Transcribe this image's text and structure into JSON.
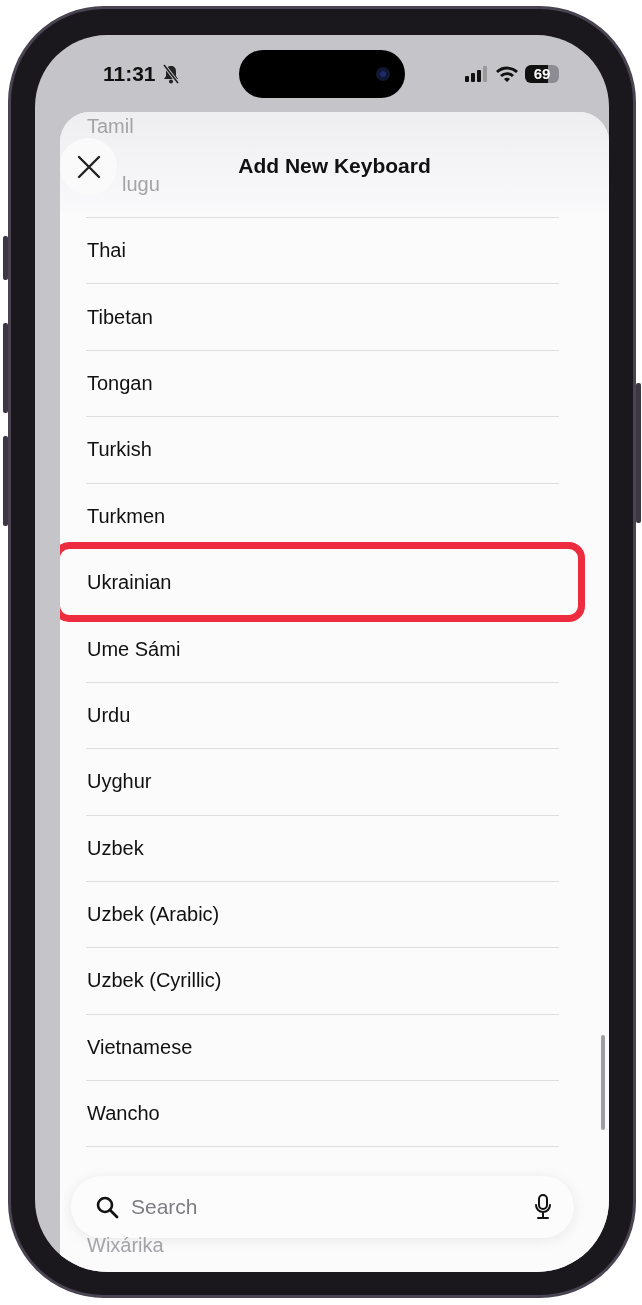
{
  "status_bar": {
    "time": "11:31",
    "silent": true,
    "battery": "69"
  },
  "sheet": {
    "title": "Add New Keyboard",
    "faded_top": [
      "Tamil",
      "lugu"
    ],
    "items": [
      {
        "label": "Thai",
        "highlighted": false
      },
      {
        "label": "Tibetan",
        "highlighted": false
      },
      {
        "label": "Tongan",
        "highlighted": false
      },
      {
        "label": "Turkish",
        "highlighted": false
      },
      {
        "label": "Turkmen",
        "highlighted": false
      },
      {
        "label": "Ukrainian",
        "highlighted": true
      },
      {
        "label": "Ume Sámi",
        "highlighted": false
      },
      {
        "label": "Urdu",
        "highlighted": false
      },
      {
        "label": "Uyghur",
        "highlighted": false
      },
      {
        "label": "Uzbek",
        "highlighted": false
      },
      {
        "label": "Uzbek (Arabic)",
        "highlighted": false
      },
      {
        "label": "Uzbek (Cyrillic)",
        "highlighted": false
      },
      {
        "label": "Vietnamese",
        "highlighted": false
      },
      {
        "label": "Wancho",
        "highlighted": false
      }
    ],
    "faded_bottom": [
      "Wixárika"
    ],
    "search": {
      "placeholder": "Search"
    }
  }
}
